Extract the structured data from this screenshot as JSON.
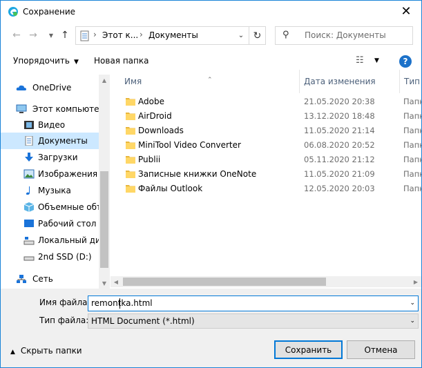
{
  "window": {
    "title": "Сохранение",
    "close_glyph": "✕"
  },
  "nav": {
    "breadcrumb": [
      "Этот к...",
      "Документы"
    ],
    "search_placeholder": "Поиск: Документы"
  },
  "toolbar": {
    "organize_label": "Упорядочить",
    "new_folder_label": "Новая папка",
    "help_glyph": "?"
  },
  "sidebar": {
    "items": [
      {
        "label": "OneDrive",
        "icon": "onedrive-icon"
      },
      {
        "label": "Этот компьютер",
        "icon": "computer-icon"
      },
      {
        "label": "Видео",
        "icon": "video-icon"
      },
      {
        "label": "Документы",
        "icon": "documents-icon",
        "selected": true
      },
      {
        "label": "Загрузки",
        "icon": "download-icon"
      },
      {
        "label": "Изображения",
        "icon": "pictures-icon"
      },
      {
        "label": "Музыка",
        "icon": "music-icon"
      },
      {
        "label": "Объемные объ",
        "icon": "3d-objects-icon"
      },
      {
        "label": "Рабочий стол",
        "icon": "desktop-icon"
      },
      {
        "label": "Локальный дис",
        "icon": "drive-icon"
      },
      {
        "label": "2nd SSD (D:)",
        "icon": "drive-icon"
      },
      {
        "label": "Сеть",
        "icon": "network-icon"
      }
    ]
  },
  "columns": {
    "name": "Имя",
    "date": "Дата изменения",
    "type": "Тип"
  },
  "files": [
    {
      "name": "Adobe",
      "date": "21.05.2020 20:38",
      "type": "Папк"
    },
    {
      "name": "AirDroid",
      "date": "13.12.2020 18:48",
      "type": "Папк"
    },
    {
      "name": "Downloads",
      "date": "11.05.2020 21:14",
      "type": "Папк"
    },
    {
      "name": "MiniTool Video Converter",
      "date": "06.08.2020 20:52",
      "type": "Папк"
    },
    {
      "name": "Publii",
      "date": "05.11.2020 21:12",
      "type": "Папк"
    },
    {
      "name": "Записные книжки OneNote",
      "date": "11.05.2020 21:09",
      "type": "Папк"
    },
    {
      "name": "Файлы Outlook",
      "date": "12.05.2020 20:03",
      "type": "Папк"
    }
  ],
  "form": {
    "filename_label": "Имя файла:",
    "filename_value": "remontka.html",
    "filetype_label": "Тип файла:",
    "filetype_value": "HTML Document (*.html)"
  },
  "footer": {
    "hide_folders_label": "Скрыть папки",
    "save_label": "Сохранить",
    "cancel_label": "Отмена"
  },
  "colors": {
    "accent": "#0078d7",
    "selection": "#cce8ff",
    "folder": "#ffd766"
  }
}
